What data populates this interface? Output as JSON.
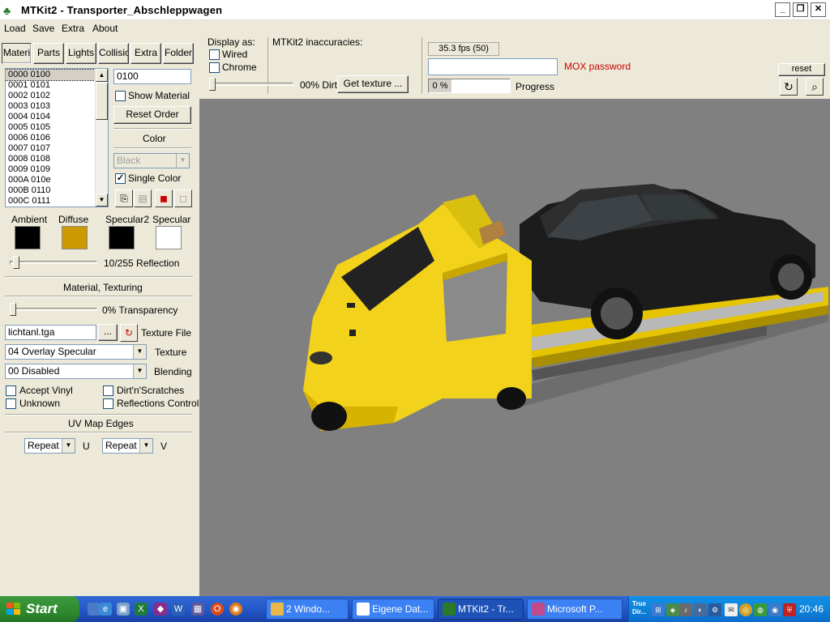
{
  "window": {
    "title": "MTKit2 - Transporter_Abschleppwagen",
    "minimize": "_",
    "maximize": "❐",
    "close": "✕"
  },
  "menu": [
    "Load",
    "Save",
    "Extra",
    "About"
  ],
  "tabs": [
    {
      "label": "Materi",
      "active": true
    },
    {
      "label": "Parts",
      "active": false
    },
    {
      "label": "Lights",
      "active": false
    },
    {
      "label": "Collisio",
      "active": false
    },
    {
      "label": "Extra",
      "active": false
    },
    {
      "label": "Folder",
      "active": false
    }
  ],
  "materials": {
    "items": [
      "0000 0100",
      "0001 0101",
      "0002 0102",
      "0003 0103",
      "0004 0104",
      "0005 0105",
      "0006 0106",
      "0007 0107",
      "0008 0108",
      "0009 0109",
      "000A 010e",
      "000B 0110",
      "000C 0111"
    ],
    "selected_index": 0,
    "id_value": "0100",
    "show_material_label": "Show Material",
    "show_material_checked": false,
    "reset_order_label": "Reset Order",
    "color_label": "Color",
    "color_value": "Black",
    "single_color_label": "Single Color",
    "single_color_checked": true
  },
  "lighting": {
    "ambient_label": "Ambient",
    "diffuse_label": "Diffuse",
    "specular2_label": "Specular2",
    "specular_label": "Specular",
    "ambient_color": "#000000",
    "diffuse_color": "#cc9900",
    "specular2_color": "#000000",
    "specular_color": "#ffffff",
    "reflection_text": "10/255 Reflection",
    "reflection_value": 10
  },
  "texturing": {
    "section_label": "Material, Texturing",
    "transparency_text": "0% Transparency",
    "transparency_value": 0,
    "texture_file_value": "lichtanl.tga",
    "browse_label": "...",
    "texture_file_label": "Texture File",
    "texture_value": "04 Overlay Specular",
    "texture_label": "Texture",
    "blending_value": "00 Disabled",
    "blending_label": "Blending",
    "accept_vinyl_label": "Accept Vinyl",
    "unknown_label": "Unknown",
    "dirt_label": "Dirt'n'Scratches",
    "reflections_control_label": "Reflections Control"
  },
  "uv": {
    "section_label": "UV Map Edges",
    "u_value": "Repeat",
    "u_label": "U",
    "v_value": "Repeat",
    "v_label": "V"
  },
  "display": {
    "label": "Display as:",
    "wired_label": "Wired",
    "chrome_label": "Chrome",
    "dirt_text": "00% Dirt",
    "dirt_value": 0,
    "get_texture_label": "Get texture ...",
    "inaccuracies_label": "MTKit2 inaccuracies:"
  },
  "status": {
    "fps": "35.3 fps (50)",
    "mox_password_label": "MOX password",
    "mox_password_value": "",
    "progress_text": "0 %",
    "progress_value": 0,
    "progress_label": "Progress",
    "reset_label": "reset",
    "refresh_icon": "↻",
    "zoom_icon": "⌕"
  },
  "taskbar": {
    "start_label": "Start",
    "tasks": [
      {
        "label": "2 Windo...",
        "active": false
      },
      {
        "label": "Eigene Dat...",
        "active": false
      },
      {
        "label": "MTKit2 - Tr...",
        "active": true
      },
      {
        "label": "Microsoft P...",
        "active": false
      }
    ],
    "tray_text": "True Dir...",
    "clock": "20:46"
  }
}
